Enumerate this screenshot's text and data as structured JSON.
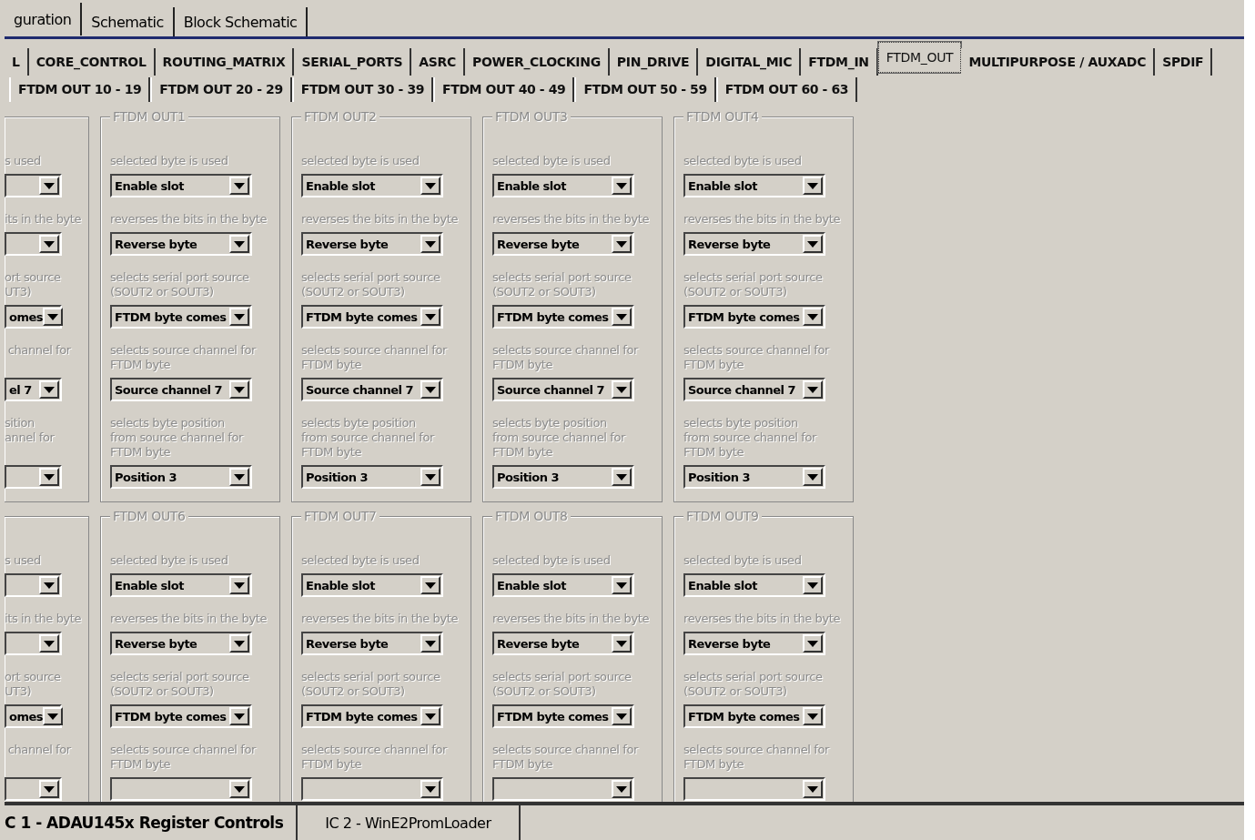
{
  "top_tabs": [
    {
      "label": "guration",
      "selected": true
    },
    {
      "label": "Schematic",
      "selected": false
    },
    {
      "label": "Block Schematic",
      "selected": false
    }
  ],
  "section_tabs": [
    {
      "label": "L",
      "selected": false
    },
    {
      "label": "CORE_CONTROL",
      "selected": false
    },
    {
      "label": "ROUTING_MATRIX",
      "selected": false
    },
    {
      "label": "SERIAL_PORTS",
      "selected": false
    },
    {
      "label": "ASRC",
      "selected": false
    },
    {
      "label": "POWER_CLOCKING",
      "selected": false
    },
    {
      "label": "PIN_DRIVE",
      "selected": false
    },
    {
      "label": "DIGITAL_MIC",
      "selected": false
    },
    {
      "label": "FTDM_IN",
      "selected": false
    },
    {
      "label": "FTDM_OUT",
      "selected": true
    },
    {
      "label": "MULTIPURPOSE / AUXADC",
      "selected": false
    },
    {
      "label": "SPDIF",
      "selected": false
    }
  ],
  "range_tabs": [
    {
      "label": "FTDM OUT 10 - 19",
      "selected": false
    },
    {
      "label": "FTDM OUT 20 - 29",
      "selected": false
    },
    {
      "label": "FTDM OUT 30 - 39",
      "selected": false
    },
    {
      "label": "FTDM OUT 40 - 49",
      "selected": false
    },
    {
      "label": "FTDM OUT 50 - 59",
      "selected": false
    },
    {
      "label": "FTDM OUT 60 - 63",
      "selected": false
    }
  ],
  "group_rows": [
    {
      "groups": [
        {
          "kind": "partial",
          "fields": [
            {
              "label": "s used"
            },
            {
              "label": "its in the byte"
            },
            {
              "label": "ort source\nUT3)",
              "value": "omes"
            },
            {
              "label": " channel for",
              "value": "el 7"
            },
            {
              "label": "sition\nannel for"
            }
          ]
        },
        {
          "kind": "full",
          "title": "FTDM OUT1",
          "fields": [
            {
              "label": "selected byte is used",
              "value": "Enable slot"
            },
            {
              "label": "reverses the bits in the byte",
              "value": "Reverse byte"
            },
            {
              "label": "selects serial port source\n(SOUT2 or SOUT3)",
              "value": "FTDM byte comes"
            },
            {
              "label": "selects source channel for\nFTDM byte",
              "value": "Source channel 7"
            },
            {
              "label": "selects byte position\nfrom source channel for\nFTDM byte",
              "value": "Position 3"
            }
          ]
        },
        {
          "kind": "full",
          "title": "FTDM OUT2",
          "fields": [
            {
              "label": "selected byte is used",
              "value": "Enable slot"
            },
            {
              "label": "reverses the bits in the byte",
              "value": "Reverse byte"
            },
            {
              "label": "selects serial port source\n(SOUT2 or SOUT3)",
              "value": "FTDM byte comes"
            },
            {
              "label": "selects source channel for\nFTDM byte",
              "value": "Source channel 7"
            },
            {
              "label": "selects byte position\nfrom source channel for\nFTDM byte",
              "value": "Position 3"
            }
          ]
        },
        {
          "kind": "full",
          "title": "FTDM OUT3",
          "fields": [
            {
              "label": "selected byte is used",
              "value": "Enable slot"
            },
            {
              "label": "reverses the bits in the byte",
              "value": "Reverse byte"
            },
            {
              "label": "selects serial port source\n(SOUT2 or SOUT3)",
              "value": "FTDM byte comes"
            },
            {
              "label": "selects source channel for\nFTDM byte",
              "value": "Source channel 7"
            },
            {
              "label": "selects byte position\nfrom source channel for\nFTDM byte",
              "value": "Position 3"
            }
          ]
        },
        {
          "kind": "full",
          "title": "FTDM OUT4",
          "fields": [
            {
              "label": "selected byte is used",
              "value": "Enable slot"
            },
            {
              "label": "reverses the bits in the byte",
              "value": "Reverse byte"
            },
            {
              "label": "selects serial port source\n(SOUT2 or SOUT3)",
              "value": "FTDM byte comes"
            },
            {
              "label": "selects source channel for\nFTDM byte",
              "value": "Source channel 7"
            },
            {
              "label": "selects byte position\nfrom source channel for\nFTDM byte",
              "value": "Position 3"
            }
          ]
        }
      ]
    },
    {
      "groups": [
        {
          "kind": "partial",
          "fields": [
            {
              "label": "s used"
            },
            {
              "label": "its in the byte"
            },
            {
              "label": "ort source\nUT3)",
              "value": "omes"
            },
            {
              "label": " channel for"
            }
          ]
        },
        {
          "kind": "full",
          "title": "FTDM OUT6",
          "fields": [
            {
              "label": "selected byte is used",
              "value": "Enable slot"
            },
            {
              "label": "reverses the bits in the byte",
              "value": "Reverse byte"
            },
            {
              "label": "selects serial port source\n(SOUT2 or SOUT3)",
              "value": "FTDM byte comes"
            },
            {
              "label": "selects source channel for\nFTDM byte"
            }
          ]
        },
        {
          "kind": "full",
          "title": "FTDM OUT7",
          "fields": [
            {
              "label": "selected byte is used",
              "value": "Enable slot"
            },
            {
              "label": "reverses the bits in the byte",
              "value": "Reverse byte"
            },
            {
              "label": "selects serial port source\n(SOUT2 or SOUT3)",
              "value": "FTDM byte comes"
            },
            {
              "label": "selects source channel for\nFTDM byte"
            }
          ]
        },
        {
          "kind": "full",
          "title": "FTDM OUT8",
          "fields": [
            {
              "label": "selected byte is used",
              "value": "Enable slot"
            },
            {
              "label": "reverses the bits in the byte",
              "value": "Reverse byte"
            },
            {
              "label": "selects serial port source\n(SOUT2 or SOUT3)",
              "value": "FTDM byte comes"
            },
            {
              "label": "selects source channel for\nFTDM byte"
            }
          ]
        },
        {
          "kind": "full",
          "title": "FTDM OUT9",
          "fields": [
            {
              "label": "selected byte is used",
              "value": "Enable slot"
            },
            {
              "label": "reverses the bits in the byte",
              "value": "Reverse byte"
            },
            {
              "label": "selects serial port source\n(SOUT2 or SOUT3)",
              "value": "FTDM byte comes"
            },
            {
              "label": "selects source channel for\nFTDM byte"
            }
          ]
        }
      ]
    }
  ],
  "bottom_tabs": [
    {
      "label": "C 1 - ADAU145x Register Controls",
      "selected": true
    },
    {
      "label": "IC 2 - WinE2PromLoader",
      "selected": false
    }
  ]
}
